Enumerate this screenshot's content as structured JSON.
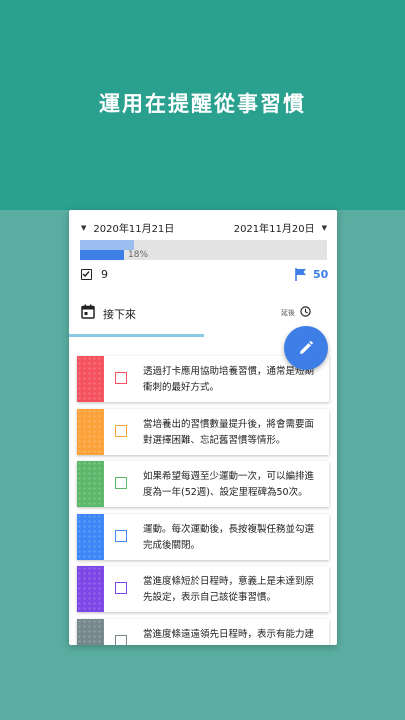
{
  "headline": "運用在提醒從事習慣",
  "header": {
    "start_date": "2020年11月21日",
    "end_date": "2021年11月20日"
  },
  "progress": {
    "previous_fraction": 0.22,
    "current_fraction": 0.18,
    "label": "18%"
  },
  "stats": {
    "checked_count": "9",
    "goal_count": "50"
  },
  "tab": {
    "label": "接下來",
    "delay_label": "延後"
  },
  "colors": {
    "accent_blue": "#3d7fe6",
    "band_teal": "#2aa08f"
  },
  "cards": [
    {
      "text": "透過打卡應用協助培養習慣，通常是短期衝刺的最好方式。",
      "color": "#f4525f"
    },
    {
      "text": "當培養出的習慣數量提升後，將會需要面對選擇困難、忘記舊習慣等情形。",
      "color": "#fba23a"
    },
    {
      "text": "如果希望每週至少運動一次，可以編排進度為一年(52週)、設定里程碑為50次。",
      "color": "#5bb86a"
    },
    {
      "text": "運動。每次運動後，長按複製任務並勾選完成後關閉。",
      "color": "#3d86f5"
    },
    {
      "text": "當進度條短於日程時，意義上是未達到原先設定，表示自己該從事習慣。",
      "color": "#7c47e6"
    },
    {
      "text": "當進度條遠遠領先日程時，表示有能力建",
      "color": "#77878d"
    }
  ]
}
